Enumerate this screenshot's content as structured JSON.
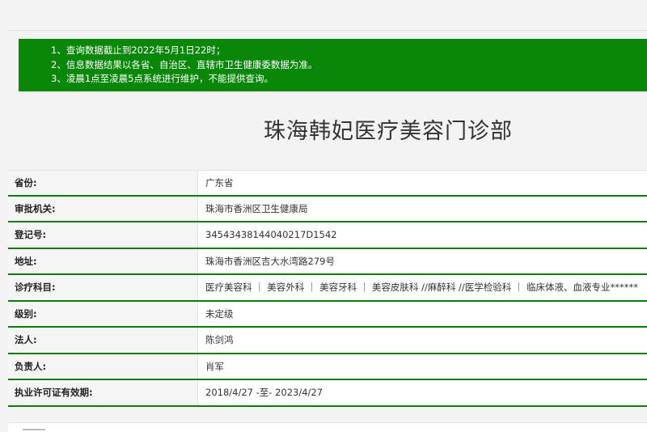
{
  "notice": {
    "lines": [
      "1、查询数据截止到2022年5月1日22时；",
      "2、信息数据结果以各省、自治区、直辖市卫生健康委数据为准。",
      "3、凌晨1点至凌晨5点系统进行维护，不能提供查询。"
    ]
  },
  "title": "珠海韩妃医疗美容门诊部",
  "rows": [
    {
      "label": "省份:",
      "value": "广东省"
    },
    {
      "label": "审批机关:",
      "value": "珠海市香洲区卫生健康局"
    },
    {
      "label": "登记号:",
      "value": "34543438144040217D1542"
    },
    {
      "label": "地址:",
      "value": "珠海市香洲区吉大水湾路279号"
    },
    {
      "label": "诊疗科目:",
      "value": "医疗美容科 ｜ 美容外科 ｜ 美容牙科 ｜ 美容皮肤科 //麻醉科 //医学检验科 ｜ 临床体液、血液专业******"
    },
    {
      "label": "级别:",
      "value": "未定级"
    },
    {
      "label": "法人:",
      "value": "陈剑鸿"
    },
    {
      "label": "负责人:",
      "value": "肖军"
    },
    {
      "label": "执业许可证有效期:",
      "value": "2018/4/27 -至- 2023/4/27"
    }
  ],
  "colors": {
    "notice_bg": "#098709",
    "row_rule": "#0e7a0e"
  }
}
